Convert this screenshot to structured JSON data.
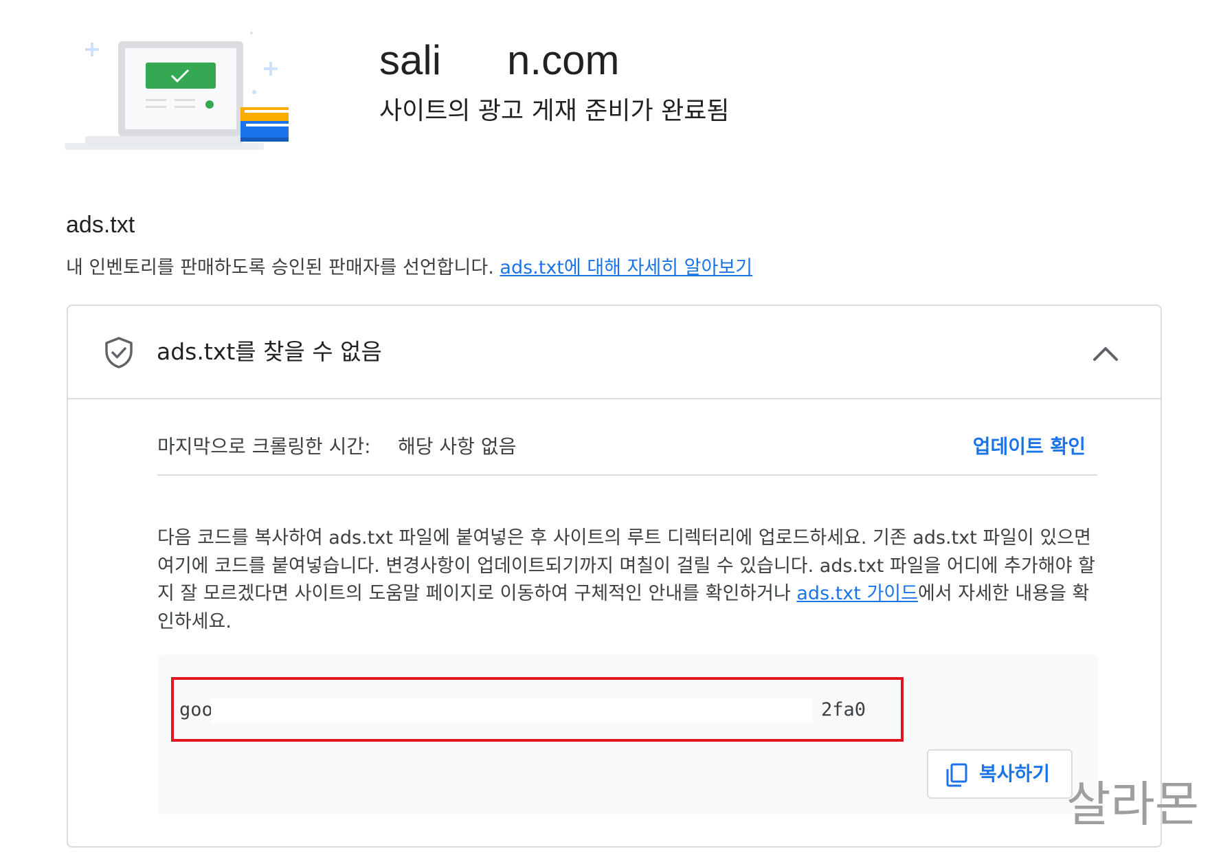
{
  "header": {
    "site_domain_visible_start": "sali",
    "site_domain_visible_end": "n.com",
    "status": "사이트의 광고 게재 준비가 완료됨"
  },
  "section": {
    "title": "ads.txt",
    "description": "내 인벤토리를 판매하도록 승인된 판매자를 선언합니다. ",
    "learn_more_link": "ads.txt에 대해 자세히 알아보기"
  },
  "card": {
    "title": "ads.txt를 찾을 수 없음",
    "status_icon": "shield-check-icon",
    "collapse_icon": "chevron-up-icon",
    "crawl": {
      "label": "마지막으로 크롤링한 시간:",
      "value": "해당 사항 없음",
      "update_button": "업데이트 확인"
    },
    "instructions": {
      "text_before_link": "다음 코드를 복사하여 ads.txt 파일에 붙여넣은 후 사이트의 루트 디렉터리에 업로드하세요. 기존 ads.txt 파일이 있으면 여기에 코드를 붙여넣습니다. 변경사항이 업데이트되기까지 며칠이 걸릴 수 있습니다. ads.txt 파일을 어디에 추가해야 할지 잘 모르겠다면 사이트의 도움말 페이지로 이동하여 구체적인 안내를 확인하거나 ",
      "link": "ads.txt 가이드",
      "text_after_link": "에서 자세한 내용을 확인하세요."
    },
    "code": {
      "visible_start": "goo",
      "visible_end": "2fa0"
    },
    "copy_button": "복사하기"
  },
  "watermark": "살라몬",
  "colors": {
    "link": "#1a73e8",
    "highlight_border": "#e2141e",
    "divider": "#dadce0",
    "code_background": "#f8f9fa",
    "success_green": "#34a853"
  }
}
